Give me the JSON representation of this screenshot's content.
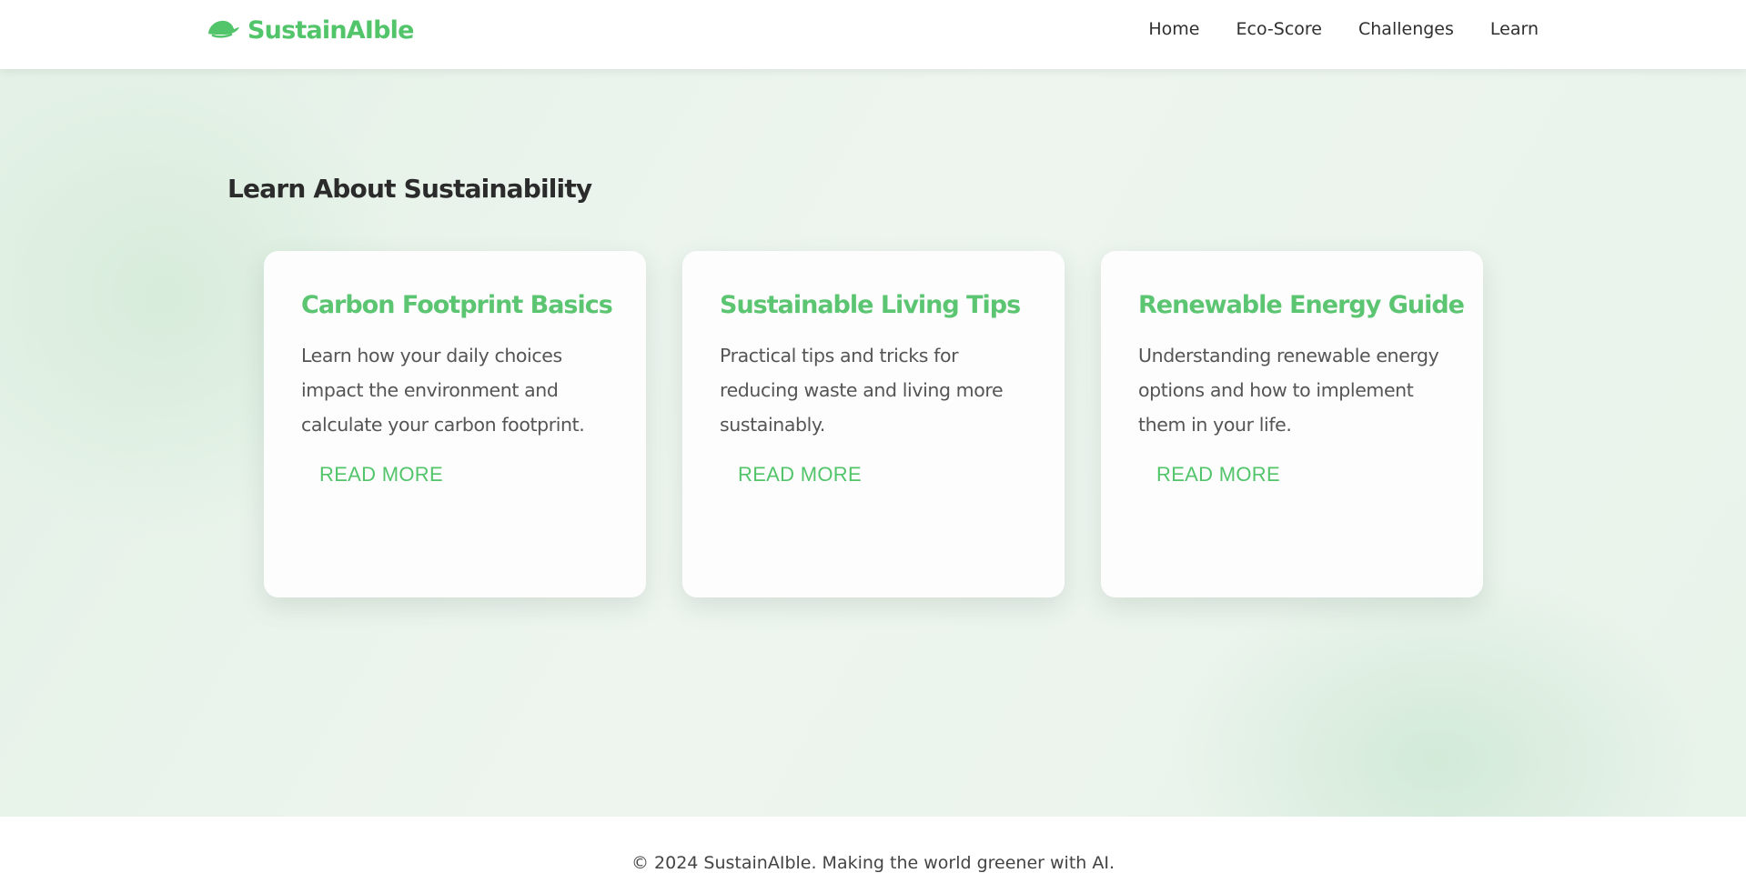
{
  "brand": {
    "name": "SustainAIble",
    "icon": "leaf-icon",
    "color": "#52c46a"
  },
  "nav": {
    "items": [
      {
        "label": "Home"
      },
      {
        "label": "Eco-Score"
      },
      {
        "label": "Challenges"
      },
      {
        "label": "Learn"
      }
    ]
  },
  "main": {
    "section_title": "Learn About Sustainability",
    "cards": [
      {
        "title": "Carbon Footprint Basics",
        "description": "Learn how your daily choices impact the environment and calculate your carbon footprint.",
        "button_label": "READ MORE"
      },
      {
        "title": "Sustainable Living Tips",
        "description": "Practical tips and tricks for reducing waste and living more sustainably.",
        "button_label": "READ MORE"
      },
      {
        "title": "Renewable Energy Guide",
        "description": "Understanding renewable energy options and how to implement them in your life.",
        "button_label": "READ MORE"
      }
    ]
  },
  "footer": {
    "text": "© 2024 SustainAIble. Making the world greener with AI."
  },
  "colors": {
    "accent": "#52c46a",
    "heading": "#2b2b2b",
    "body_text": "#555555",
    "background": "#e8f3ea"
  }
}
